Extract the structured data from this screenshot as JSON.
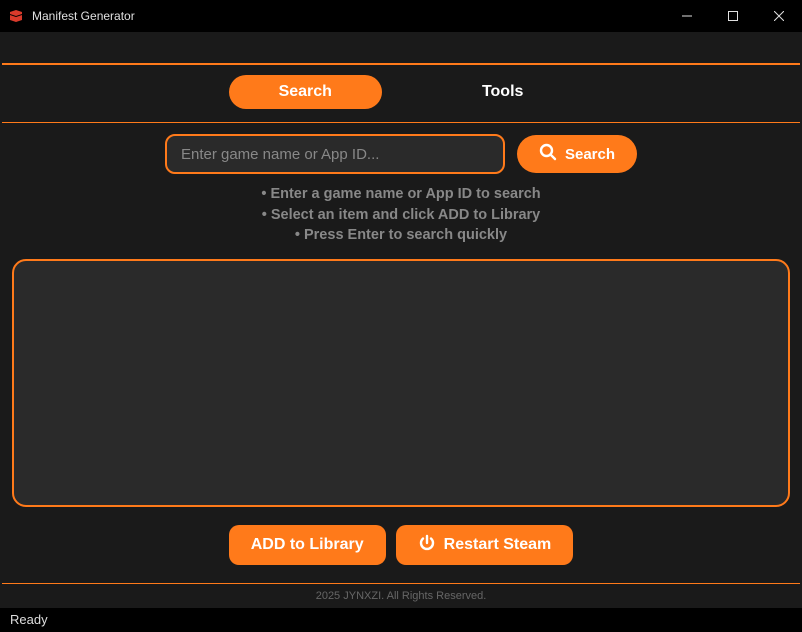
{
  "titlebar": {
    "app_title": "Manifest Generator"
  },
  "tabs": {
    "search": "Search",
    "tools": "Tools"
  },
  "search": {
    "placeholder": "Enter game name or App ID...",
    "button_label": "Search"
  },
  "instructions": {
    "line1": "• Enter a game name or App ID to search",
    "line2": "• Select an item and click ADD to Library",
    "line3": "• Press Enter to search quickly"
  },
  "actions": {
    "add_label": "ADD to Library",
    "restart_label": "Restart Steam"
  },
  "footer": {
    "copyright": "2025 JYNXZI. All Rights Reserved."
  },
  "status": {
    "text": "Ready"
  }
}
